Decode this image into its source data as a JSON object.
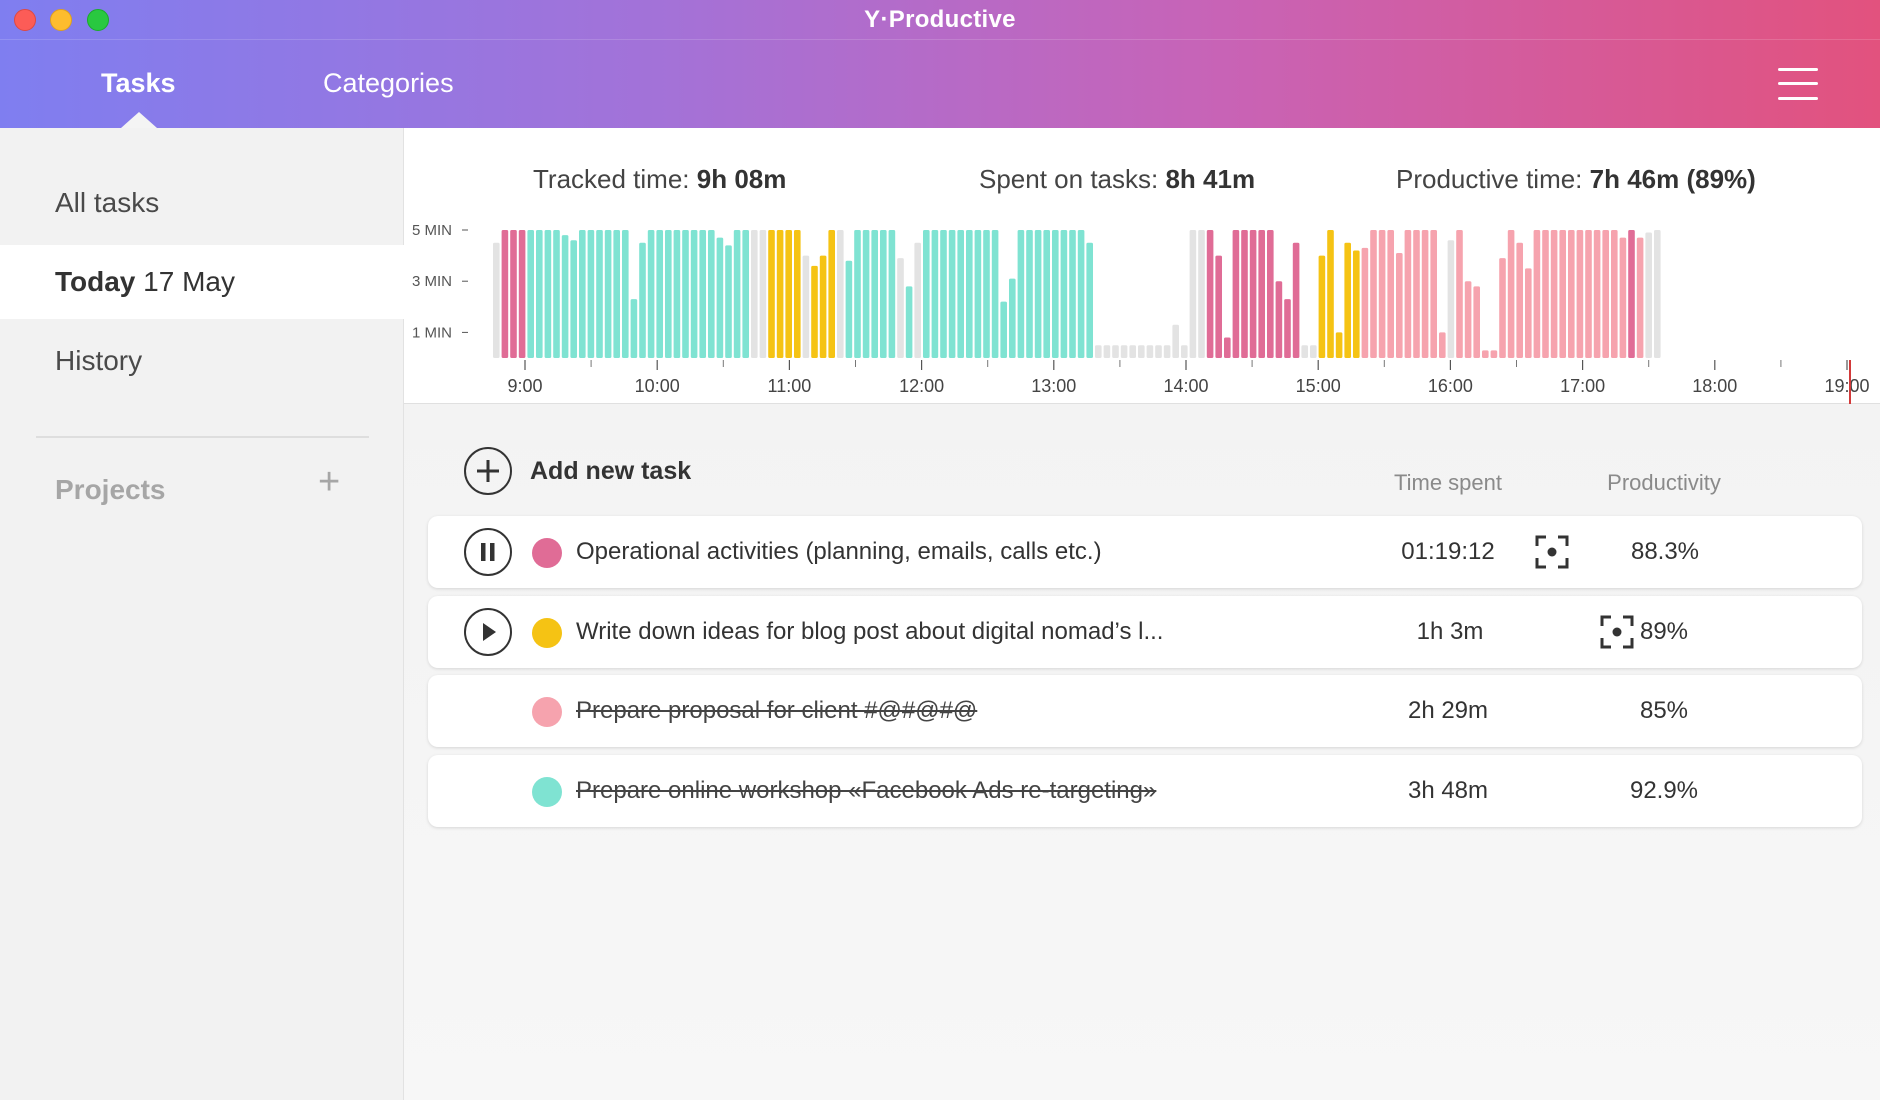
{
  "window": {
    "title": "Y·Productive"
  },
  "nav": {
    "tabs": [
      {
        "label": "Tasks",
        "active": true
      },
      {
        "label": "Categories",
        "active": false
      }
    ],
    "menu_icon": "hamburger-menu-icon"
  },
  "sidebar": {
    "all_tasks": "All tasks",
    "today": {
      "label": "Today",
      "date": "17 May"
    },
    "history": "History",
    "projects_label": "Projects",
    "projects_add": "+"
  },
  "stats": {
    "tracked_label": "Tracked time:",
    "tracked_value": "9h 08m",
    "spent_label": "Spent on tasks:",
    "spent_value": "8h 41m",
    "productive_label": "Productive time:",
    "productive_value": "7h 46m (89%)"
  },
  "timeline": {
    "y_labels": [
      "5 MIN",
      "3 MIN",
      "1 MIN"
    ],
    "hours": [
      "9:00",
      "10:00",
      "11:00",
      "12:00",
      "13:00",
      "14:00",
      "15:00",
      "16:00",
      "17:00",
      "18:00",
      "19:00"
    ],
    "colors": {
      "P": "#e06c96",
      "T": "#7fe3d2",
      "Y": "#f5c314",
      "S": "#f6a3ae",
      "G": "#e3e3e3"
    },
    "current_time": "19:00",
    "segments": [
      {
        "c": "G",
        "v": [
          4.5
        ]
      },
      {
        "c": "P",
        "v": [
          5,
          5,
          5
        ]
      },
      {
        "c": "T",
        "v": [
          5,
          5,
          5,
          5,
          4.8,
          4.6,
          5,
          5,
          5,
          5,
          5,
          5,
          2.3,
          4.5,
          5,
          5,
          5,
          5,
          5,
          5,
          5,
          5,
          4.7,
          4.4,
          5,
          5
        ]
      },
      {
        "c": "G",
        "v": [
          5,
          5
        ]
      },
      {
        "c": "Y",
        "v": [
          5,
          5,
          5,
          5
        ]
      },
      {
        "c": "G",
        "v": [
          4
        ]
      },
      {
        "c": "Y",
        "v": [
          3.6,
          4,
          5
        ]
      },
      {
        "c": "G",
        "v": [
          5
        ]
      },
      {
        "c": "T",
        "v": [
          3.8,
          5,
          5,
          5,
          5,
          5
        ]
      },
      {
        "c": "G",
        "v": [
          3.9
        ]
      },
      {
        "c": "T",
        "v": [
          2.8
        ]
      },
      {
        "c": "G",
        "v": [
          4.5
        ]
      },
      {
        "c": "T",
        "v": [
          5,
          5,
          5,
          5,
          5,
          5,
          5,
          5,
          5,
          2.2,
          3.1,
          5,
          5,
          5,
          5,
          5,
          5,
          5,
          5,
          4.5
        ]
      },
      {
        "c": "G",
        "v": [
          0.5,
          0.5,
          0.5,
          0.5,
          0.5,
          0.5,
          0.5,
          0.5,
          0.5,
          1.3,
          0.5,
          5,
          5
        ]
      },
      {
        "c": "P",
        "v": [
          5,
          4,
          0.8,
          5,
          5,
          5,
          5,
          5,
          3,
          2.3
        ]
      },
      {
        "c": "P",
        "v": [
          4.5
        ]
      },
      {
        "c": "G",
        "v": [
          0.5,
          0.5
        ]
      },
      {
        "c": "Y",
        "v": [
          4,
          5,
          1,
          4.5,
          4.2
        ]
      },
      {
        "c": "S",
        "v": [
          4.3,
          5,
          5,
          5,
          4.1,
          5,
          5,
          5,
          5
        ]
      },
      {
        "c": "S",
        "v": [
          1
        ]
      },
      {
        "c": "G",
        "v": [
          4.6
        ]
      },
      {
        "c": "S",
        "v": [
          5,
          3,
          2.8
        ]
      },
      {
        "c": "S",
        "v": [
          0.3,
          0.3
        ]
      },
      {
        "c": "S",
        "v": [
          3.9,
          5,
          4.5,
          3.5,
          5,
          5,
          5,
          5,
          5,
          5,
          5,
          5,
          5,
          5,
          4.7
        ]
      },
      {
        "c": "P",
        "v": [
          5
        ]
      },
      {
        "c": "S",
        "v": [
          4.7
        ]
      },
      {
        "c": "G",
        "v": [
          4.9,
          5
        ]
      }
    ]
  },
  "tasks": {
    "add_label": "Add new task",
    "col_time": "Time spent",
    "col_productivity": "Productivity",
    "rows": [
      {
        "control": "pause",
        "color": "#e06c96",
        "name": "Operational activities (planning, emails, calls etc.)",
        "focus": true,
        "time": "01:19:12",
        "productivity": "88.3%",
        "done": false
      },
      {
        "control": "play",
        "color": "#f5c314",
        "name": "Write down ideas for blog post about digital nomad’s l...",
        "focus": true,
        "time": "1h 3m",
        "productivity": "89%",
        "done": false
      },
      {
        "control": "none",
        "color": "#f6a3ae",
        "name": "Prepare proposal for client #@#@#@",
        "focus": false,
        "time": "2h 29m",
        "productivity": "85%",
        "done": true
      },
      {
        "control": "none",
        "color": "#7fe3d2",
        "name": "Prepare online workshop «Facebook Ads re-targeting»",
        "focus": false,
        "time": "3h 48m",
        "productivity": "92.9%",
        "done": true
      }
    ]
  }
}
